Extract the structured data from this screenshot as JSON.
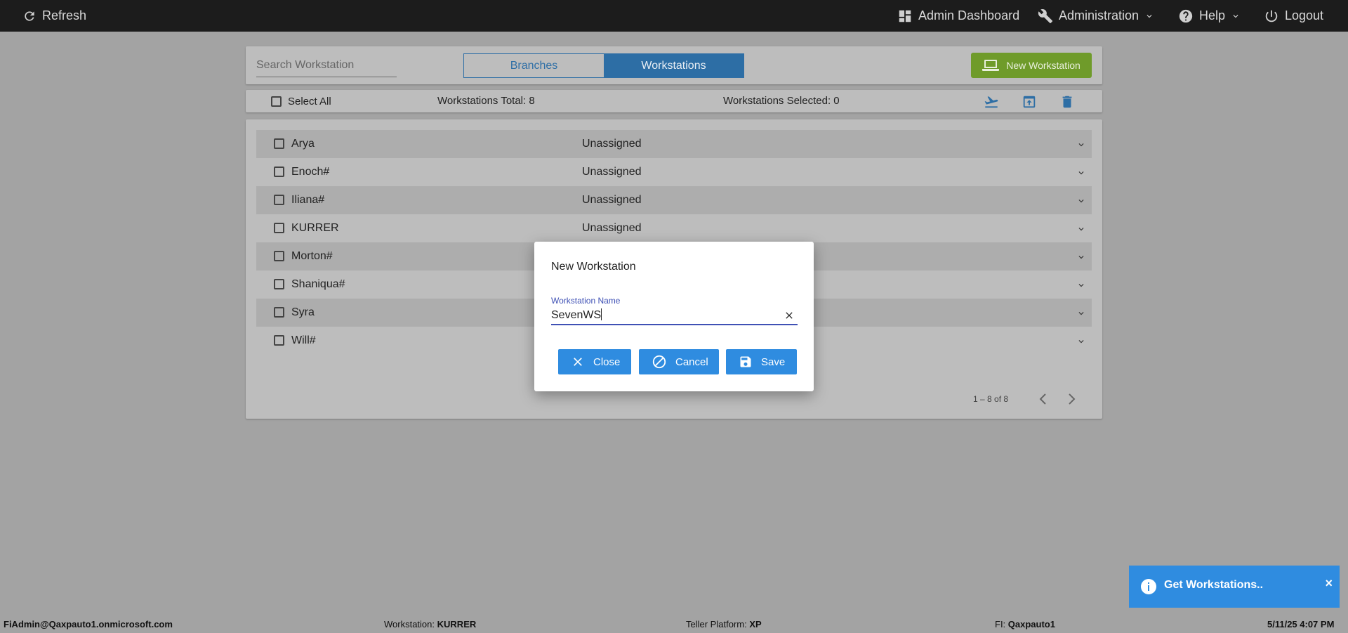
{
  "topbar": {
    "refresh": "Refresh",
    "admin_dashboard": "Admin Dashboard",
    "administration": "Administration",
    "help": "Help",
    "logout": "Logout"
  },
  "toolbar": {
    "search_placeholder": "Search Workstation",
    "tabs": [
      {
        "label": "Branches",
        "active": false
      },
      {
        "label": "Workstations",
        "active": true
      }
    ],
    "new_button": "New Workstation",
    "select_all": "Select All",
    "total": "Workstations Total: 8",
    "selected": "Workstations Selected: 0"
  },
  "rows": [
    {
      "name": "Arya",
      "status": "Unassigned"
    },
    {
      "name": "Enoch#",
      "status": "Unassigned"
    },
    {
      "name": "Iliana#",
      "status": "Unassigned"
    },
    {
      "name": "KURRER",
      "status": "Unassigned"
    },
    {
      "name": "Morton#",
      "status": ""
    },
    {
      "name": "Shaniqua#",
      "status": ""
    },
    {
      "name": "Syra",
      "status": ""
    },
    {
      "name": "Will#",
      "status": ""
    }
  ],
  "pager": "1 – 8 of 8",
  "dialog": {
    "title": "New Workstation",
    "field_label": "Workstation Name",
    "field_value": "SevenWS",
    "close": "Close",
    "cancel": "Cancel",
    "save": "Save"
  },
  "toast": {
    "text": "Get Workstations.."
  },
  "status": {
    "user": "FiAdmin@Qaxpauto1.onmicrosoft.com",
    "workstation_label": "Workstation:",
    "workstation": "KURRER",
    "platform_label": "Teller Platform:",
    "platform": "XP",
    "fi_label": "FI:",
    "fi": "Qaxpauto1",
    "datetime": "5/11/25 4:07 PM"
  },
  "colors": {
    "primary": "#2f8ce0",
    "tab_active": "#2d6ea5",
    "new_button": "#6f9b2a",
    "topbar": "#1c1c1c"
  }
}
